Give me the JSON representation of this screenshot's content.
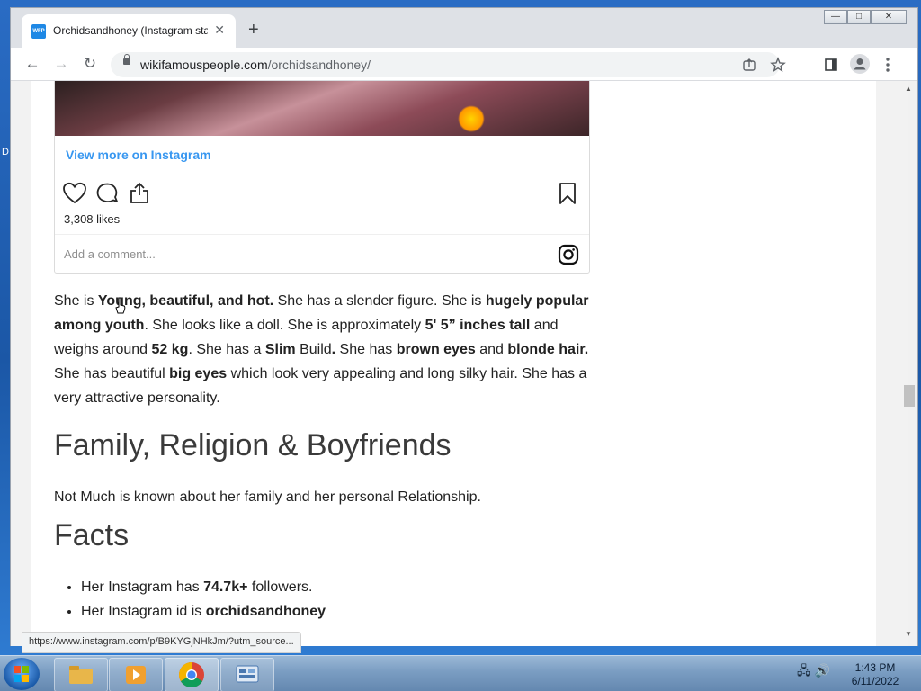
{
  "desktop": {
    "edge_label": "D"
  },
  "browser": {
    "tab": {
      "favicon": "WFP",
      "title": "Orchidsandhoney (Instagram sta",
      "close": "✕"
    },
    "new_tab": "+",
    "window_controls": {
      "minimize": "—",
      "maximize": "□",
      "close": "✕"
    },
    "nav": {
      "back": "←",
      "forward": "→",
      "reload": "↻"
    },
    "url": {
      "domain": "wikifamouspeople.com",
      "path": "/orchidsandhoney/"
    }
  },
  "embed": {
    "view_more": "View more on Instagram",
    "likes": "3,308 likes",
    "comment_placeholder": "Add a comment..."
  },
  "article": {
    "para": [
      {
        "t": "She is ",
        "b": false
      },
      {
        "t": "Young, beautiful, and hot.",
        "b": true
      },
      {
        "t": " She has a slender figure. She is ",
        "b": false
      },
      {
        "t": "hugely popular among youth",
        "b": true
      },
      {
        "t": ". She looks like a doll. She is approximately ",
        "b": false
      },
      {
        "t": "5' 5” inches tall",
        "b": true
      },
      {
        "t": " and weighs around ",
        "b": false
      },
      {
        "t": "52 kg",
        "b": true
      },
      {
        "t": ". She has a ",
        "b": false
      },
      {
        "t": "Slim",
        "b": true
      },
      {
        "t": " Build",
        "b": false
      },
      {
        "t": ".",
        "b": true
      },
      {
        "t": " She has ",
        "b": false
      },
      {
        "t": "brown eyes",
        "b": true
      },
      {
        "t": " and ",
        "b": false
      },
      {
        "t": "blonde hair.",
        "b": true
      },
      {
        "t": " She has beautiful ",
        "b": false
      },
      {
        "t": "big eyes",
        "b": true
      },
      {
        "t": " which look very appealing and long silky hair. She has a very attractive personality.",
        "b": false
      }
    ],
    "family_heading": "Family, Religion & Boyfriends",
    "family_text": "Not Much is known about her family and her personal Relationship.",
    "facts_heading": "Facts",
    "facts": [
      {
        "text": "Her Instagram has ",
        "bold": "74.7k+",
        "after": " followers."
      },
      {
        "text": "Her Instagram id is ",
        "bold": "orchidsandhoney",
        "after": ""
      }
    ]
  },
  "status_url": "https://www.instagram.com/p/B9KYGjNHkJm/?utm_source...",
  "taskbar": {
    "apps": [
      "windows-explorer",
      "media-player",
      "chrome",
      "control-panel"
    ],
    "time": "1:43 PM",
    "date": "6/11/2022"
  }
}
